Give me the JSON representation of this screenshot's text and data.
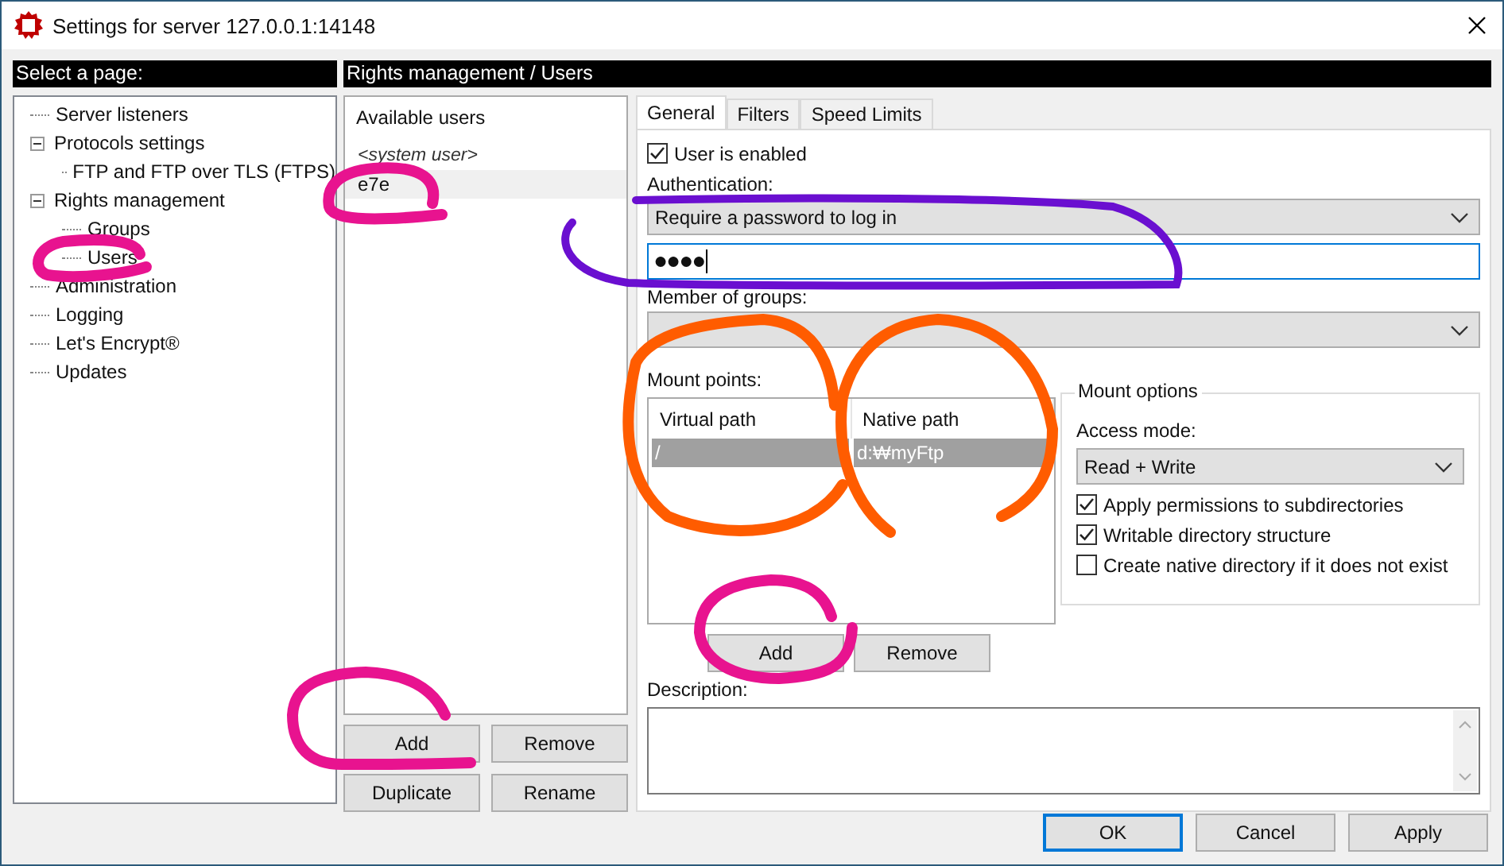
{
  "window": {
    "title": "Settings for server 127.0.0.1:14148"
  },
  "page_list": {
    "header": "Select a page:",
    "items": [
      {
        "label": "Server listeners"
      },
      {
        "label": "Protocols settings",
        "expanded": true,
        "children": [
          {
            "label": "FTP and FTP over TLS (FTPS)"
          }
        ]
      },
      {
        "label": "Rights management",
        "expanded": true,
        "children": [
          {
            "label": "Groups"
          },
          {
            "label": "Users"
          }
        ]
      },
      {
        "label": "Administration"
      },
      {
        "label": "Logging"
      },
      {
        "label": "Let's Encrypt®"
      },
      {
        "label": "Updates"
      }
    ]
  },
  "content_header": "Rights management / Users",
  "users": {
    "label": "Available users",
    "items": [
      {
        "name": "<system user>",
        "kind": "system",
        "selected": false
      },
      {
        "name": "e7e",
        "kind": "user",
        "selected": true
      }
    ],
    "buttons": [
      "Add",
      "Remove",
      "Duplicate",
      "Rename"
    ]
  },
  "tabs": [
    {
      "label": "General",
      "selected": true
    },
    {
      "label": "Filters",
      "selected": false
    },
    {
      "label": "Speed Limits",
      "selected": false
    }
  ],
  "general": {
    "user_enabled": {
      "label": "User is enabled",
      "checked": true
    },
    "authentication": {
      "label": "Authentication:",
      "value": "Require a password to log in"
    },
    "password": {
      "value": "●●●●"
    },
    "groups": {
      "label": "Member of groups:"
    },
    "mount_points": {
      "label": "Mount points:",
      "columns": [
        "Virtual path",
        "Native path"
      ],
      "rows": [
        {
          "cells": [
            "/",
            "d:₩myFtp"
          ],
          "selected": true
        }
      ],
      "buttons": [
        "Add",
        "Remove"
      ]
    },
    "mount_options": {
      "title": "Mount options",
      "access_label": "Access mode:",
      "access_value": "Read + Write",
      "options": [
        {
          "label": "Apply permissions to subdirectories",
          "checked": true
        },
        {
          "label": "Writable directory structure",
          "checked": true
        },
        {
          "label": "Create native directory if it does not exist",
          "checked": false
        }
      ]
    },
    "description": {
      "label": "Description:"
    }
  },
  "dialog_buttons": [
    {
      "label": "OK",
      "default": true
    },
    {
      "label": "Cancel",
      "default": false
    },
    {
      "label": "Apply",
      "default": false
    }
  ]
}
